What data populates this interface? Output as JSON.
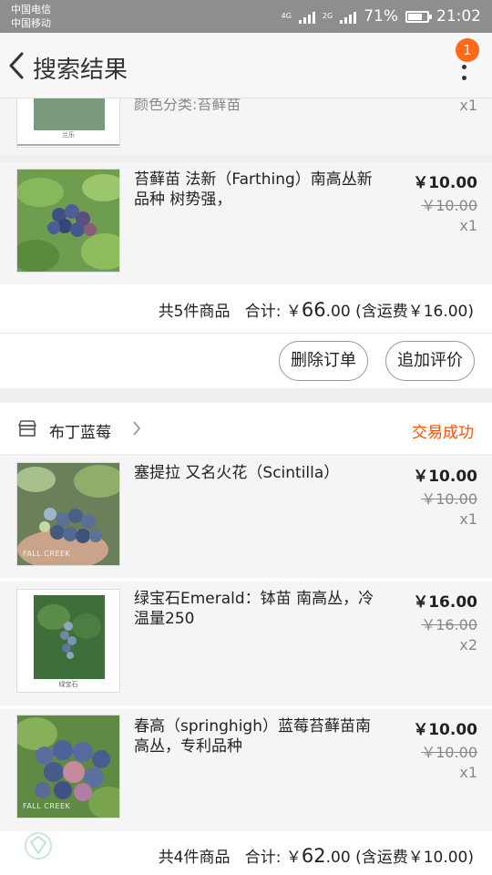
{
  "status_bar": {
    "carrier_1": "中国电信",
    "carrier_2": "中国移动",
    "net_1": "4G",
    "net_2": "2G",
    "battery": "71%",
    "time": "21:02"
  },
  "header": {
    "title": "搜索结果",
    "badge": "1"
  },
  "orders": [
    {
      "items": [
        {
          "name": "颜色分类:苔藓苗",
          "qty": "x1",
          "caption": "兰乐"
        },
        {
          "name": "苔藓苗 法新（Farthing）南高丛新品种 树势强，",
          "price": "￥10.00",
          "original_price": "￥10.00",
          "qty": "x1"
        }
      ],
      "summary": {
        "count": "共5件商品",
        "total_label": "合计: ￥",
        "total_big": "66",
        "total_small": ".00",
        "shipping": "(含运费￥16.00)"
      },
      "buttons": [
        "删除订单",
        "追加评价"
      ]
    },
    {
      "shop": "布丁蓝莓",
      "status": "交易成功",
      "items": [
        {
          "name": "塞提拉 又名火花（Scintilla）",
          "price": "￥10.00",
          "original_price": "￥10.00",
          "qty": "x1",
          "watermark": "FALL CREEK"
        },
        {
          "name": "绿宝石Emerald：钵苗 南高丛，冷温量250",
          "price": "￥16.00",
          "original_price": "￥16.00",
          "qty": "x2",
          "caption": "绿宝石"
        },
        {
          "name": "春高（springhigh）蓝莓苔藓苗南高丛，专利品种",
          "price": "￥10.00",
          "original_price": "￥10.00",
          "qty": "x1",
          "watermark": "FALL CREEK"
        }
      ],
      "summary": {
        "count": "共4件商品",
        "total_label": "合计: ￥",
        "total_big": "62",
        "total_small": ".00",
        "shipping": "(含运费￥10.00)"
      }
    }
  ]
}
